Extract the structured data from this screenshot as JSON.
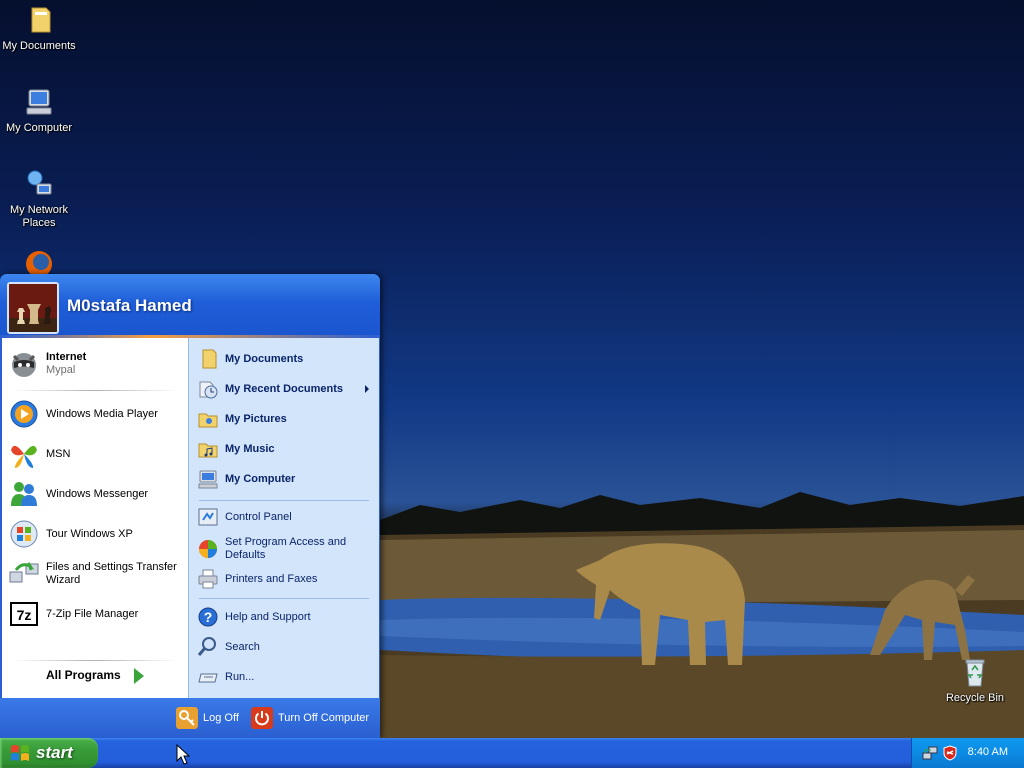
{
  "desktop": {
    "icons": [
      {
        "label": "My Documents"
      },
      {
        "label": "My Computer"
      },
      {
        "label": "My Network Places"
      },
      {
        "label": "Recycle Bin"
      }
    ]
  },
  "start_menu": {
    "user_name": "M0stafa Hamed",
    "pinned": [
      {
        "title": "Internet",
        "subtitle": "Mypal"
      }
    ],
    "recent": [
      {
        "label": "Windows Media Player"
      },
      {
        "label": "MSN"
      },
      {
        "label": "Windows Messenger"
      },
      {
        "label": "Tour Windows XP"
      },
      {
        "label": "Files and Settings Transfer Wizard"
      },
      {
        "label": "7-Zip File Manager"
      }
    ],
    "all_programs": "All Programs",
    "places": [
      {
        "label": "My Documents"
      },
      {
        "label": "My Recent Documents"
      },
      {
        "label": "My Pictures"
      },
      {
        "label": "My Music"
      },
      {
        "label": "My Computer"
      }
    ],
    "settings": [
      {
        "label": "Control Panel"
      },
      {
        "label": "Set Program Access and Defaults"
      },
      {
        "label": "Printers and Faxes"
      }
    ],
    "tools": [
      {
        "label": "Help and Support"
      },
      {
        "label": "Search"
      },
      {
        "label": "Run..."
      }
    ],
    "footer": {
      "log_off": "Log Off",
      "turn_off": "Turn Off Computer"
    }
  },
  "taskbar": {
    "start_label": "start",
    "clock": "8:40 AM"
  },
  "colors": {
    "taskbar_blue": "#245edb",
    "start_green": "#389c38",
    "tray_blue": "#0c8be4",
    "menu_right_pane": "#d3e5fa",
    "log_off_orange": "#e8a030",
    "turn_off_red": "#d83a1c"
  },
  "icons": {
    "internet": "raccoon-icon",
    "media_player": "media-player-icon",
    "msn": "msn-butterfly-icon",
    "messenger": "messenger-icon",
    "tour": "tour-icon",
    "transfer": "transfer-wizard-icon",
    "sevenzip": "7zip-icon"
  }
}
